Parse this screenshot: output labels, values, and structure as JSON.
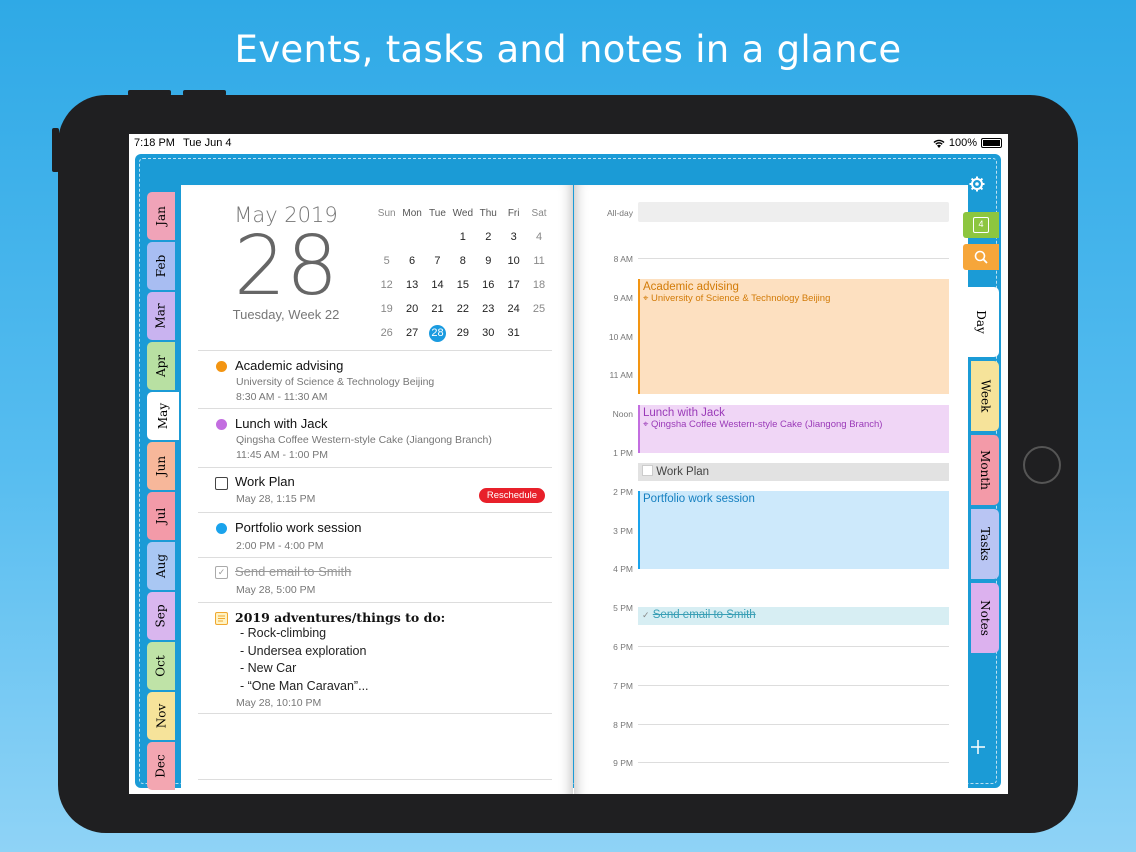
{
  "headline": "Events, tasks and notes in a glance",
  "status_bar": {
    "time": "7:18 PM",
    "date": "Tue Jun 4",
    "battery": "100%"
  },
  "months": [
    {
      "label": "Jan",
      "color": "#f0a3b8"
    },
    {
      "label": "Feb",
      "color": "#a8bdf2"
    },
    {
      "label": "Mar",
      "color": "#c9b3f0"
    },
    {
      "label": "Apr",
      "color": "#b8e0a2"
    },
    {
      "label": "May",
      "color": "#ffffff"
    },
    {
      "label": "Jun",
      "color": "#f7b79a"
    },
    {
      "label": "Jul",
      "color": "#f39aa8"
    },
    {
      "label": "Aug",
      "color": "#a9c7f3"
    },
    {
      "label": "Sep",
      "color": "#d9b6ee"
    },
    {
      "label": "Oct",
      "color": "#bfe3a7"
    },
    {
      "label": "Nov",
      "color": "#f6e39a"
    },
    {
      "label": "Dec",
      "color": "#f3a6b1"
    }
  ],
  "big_date": {
    "month_year": "May 2019",
    "day": "28",
    "weekday_week": "Tuesday, Week 22"
  },
  "mini_calendar": {
    "weekdays": [
      "Sun",
      "Mon",
      "Tue",
      "Wed",
      "Thu",
      "Fri",
      "Sat"
    ],
    "weeks": [
      [
        "",
        "",
        "",
        "1",
        "2",
        "3",
        "4"
      ],
      [
        "5",
        "6",
        "7",
        "8",
        "9",
        "10",
        "11"
      ],
      [
        "12",
        "13",
        "14",
        "15",
        "16",
        "17",
        "18"
      ],
      [
        "19",
        "20",
        "21",
        "22",
        "23",
        "24",
        "25"
      ],
      [
        "26",
        "27",
        "28",
        "29",
        "30",
        "31",
        ""
      ]
    ],
    "selected": "28"
  },
  "agenda": [
    {
      "type": "event",
      "title": "Academic advising",
      "location": "University of Science & Technology Beijing",
      "time": "8:30 AM - 11:30 AM",
      "color": "#f39512"
    },
    {
      "type": "event",
      "title": "Lunch with Jack",
      "location": "Qingsha Coffee Western-style Cake (Jiangong Branch)",
      "time": "11:45 AM - 1:00 PM",
      "color": "#c36ee0"
    },
    {
      "type": "task",
      "title": "Work Plan",
      "time": "May 28, 1:15 PM",
      "badge": "Reschedule"
    },
    {
      "type": "event",
      "title": "Portfolio work session",
      "time": "2:00 PM - 4:00 PM",
      "color": "#1aa3ec"
    },
    {
      "type": "task_done",
      "title": "Send email to Smith",
      "time": "May 28, 5:00 PM"
    },
    {
      "type": "note",
      "title": "2019 adventures/things to do:",
      "lines": [
        " - Rock-climbing",
        " - Undersea exploration",
        " - New Car",
        " - “One Man Caravan”..."
      ],
      "time": "May 28, 10:10 PM"
    }
  ],
  "timeline": {
    "allday_label": "All-day",
    "hours": [
      "8 AM",
      "9 AM",
      "10 AM",
      "11 AM",
      "Noon",
      "1 PM",
      "2 PM",
      "3 PM",
      "4 PM",
      "5 PM",
      "6 PM",
      "7 PM",
      "8 PM",
      "9 PM"
    ],
    "events": [
      {
        "title": "Academic advising",
        "location": "University of Science & Technology Beijing",
        "bg": "#fde0c0",
        "border": "#f39512",
        "color": "#d27b08"
      },
      {
        "title": "Lunch with Jack",
        "location": "Qingsha Coffee Western-style Cake (Jiangong Branch)",
        "bg": "#f0d6f6",
        "border": "#c36ee0",
        "color": "#9a3ab8"
      },
      {
        "title": "Work Plan",
        "bg": "#e2e2e2",
        "color": "#444"
      },
      {
        "title": "Portfolio work session",
        "bg": "#cde9fb",
        "border": "#1aa3ec",
        "color": "#1680c0"
      },
      {
        "title": "Send email to Smith",
        "bg": "#d7eef3",
        "color": "#3a9fb5"
      }
    ]
  },
  "right_tabs": [
    {
      "label": "Day",
      "color": "#ffffff"
    },
    {
      "label": "Week",
      "color": "#f6e39a"
    },
    {
      "label": "Month",
      "color": "#f39aa8"
    },
    {
      "label": "Tasks",
      "color": "#b9c5f3"
    },
    {
      "label": "Notes",
      "color": "#dcb1ee"
    }
  ],
  "side_icons": {
    "settings": "gear-icon",
    "calendar": "calendar-icon",
    "calendar_day": "4",
    "search": "search-icon",
    "add": "plus-icon"
  }
}
